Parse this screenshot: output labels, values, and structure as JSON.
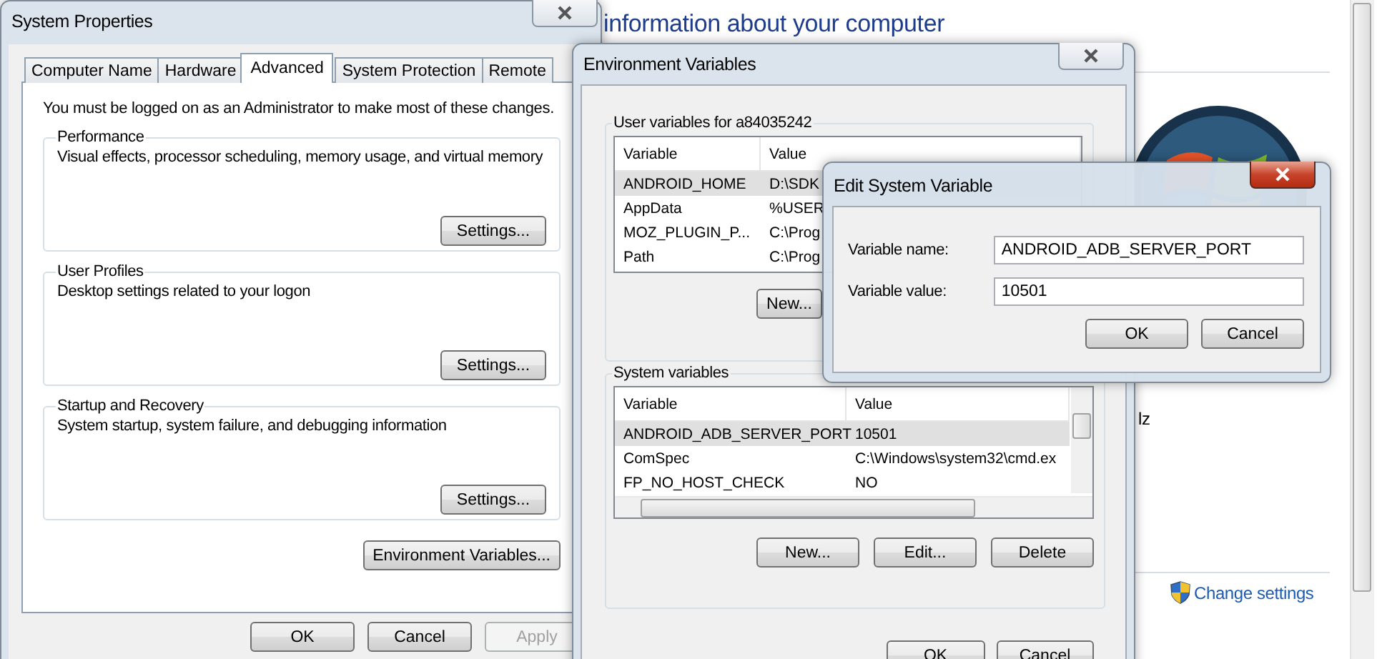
{
  "background_window": {
    "title": "information about your computer",
    "fragment": "lz",
    "link": "Change settings"
  },
  "system_properties": {
    "title": "System Properties",
    "tabs": [
      {
        "label": "Computer Name",
        "selected": false
      },
      {
        "label": "Hardware",
        "selected": false
      },
      {
        "label": "Advanced",
        "selected": true
      },
      {
        "label": "System Protection",
        "selected": false
      },
      {
        "label": "Remote",
        "selected": false
      }
    ],
    "notice": "You must be logged on as an Administrator to make most of these changes.",
    "groups": [
      {
        "title": "Performance",
        "description": "Visual effects, processor scheduling, memory usage, and virtual memory",
        "button": "Settings..."
      },
      {
        "title": "User Profiles",
        "description": "Desktop settings related to your logon",
        "button": "Settings..."
      },
      {
        "title": "Startup and Recovery",
        "description": "System startup, system failure, and debugging information",
        "button": "Settings..."
      }
    ],
    "environment_button": "Environment Variables...",
    "buttons": [
      {
        "label": "OK",
        "disabled": false
      },
      {
        "label": "Cancel",
        "disabled": false
      },
      {
        "label": "Apply",
        "disabled": true
      }
    ]
  },
  "environment_variables": {
    "title": "Environment Variables",
    "user_variables": {
      "title": "User variables for a84035242",
      "columns": [
        "Variable",
        "Value"
      ],
      "rows": [
        {
          "variable": "ANDROID_HOME",
          "value": "D:\\SDK",
          "selected": true
        },
        {
          "variable": "AppData",
          "value": "%USER",
          "selected": false
        },
        {
          "variable": "MOZ_PLUGIN_P...",
          "value": "C:\\Prog",
          "selected": false
        },
        {
          "variable": "Path",
          "value": "C:\\Prog",
          "selected": false
        }
      ],
      "buttons": [
        "New..."
      ]
    },
    "system_variables": {
      "title": "System variables",
      "columns": [
        "Variable",
        "Value"
      ],
      "rows": [
        {
          "variable": "ANDROID_ADB_SERVER_PORT",
          "value": "10501",
          "selected": true
        },
        {
          "variable": "ComSpec",
          "value": "C:\\Windows\\system32\\cmd.ex",
          "selected": false
        },
        {
          "variable": "FP_NO_HOST_CHECK",
          "value": "NO",
          "selected": false
        }
      ],
      "buttons": [
        "New...",
        "Edit...",
        "Delete"
      ]
    },
    "buttons": [
      "OK",
      "Cancel"
    ]
  },
  "edit_dialog": {
    "title": "Edit System Variable",
    "fields": [
      {
        "label": "Variable name:",
        "value": "ANDROID_ADB_SERVER_PORT"
      },
      {
        "label": "Variable value:",
        "value": "10501"
      }
    ],
    "buttons": [
      "OK",
      "Cancel"
    ]
  }
}
